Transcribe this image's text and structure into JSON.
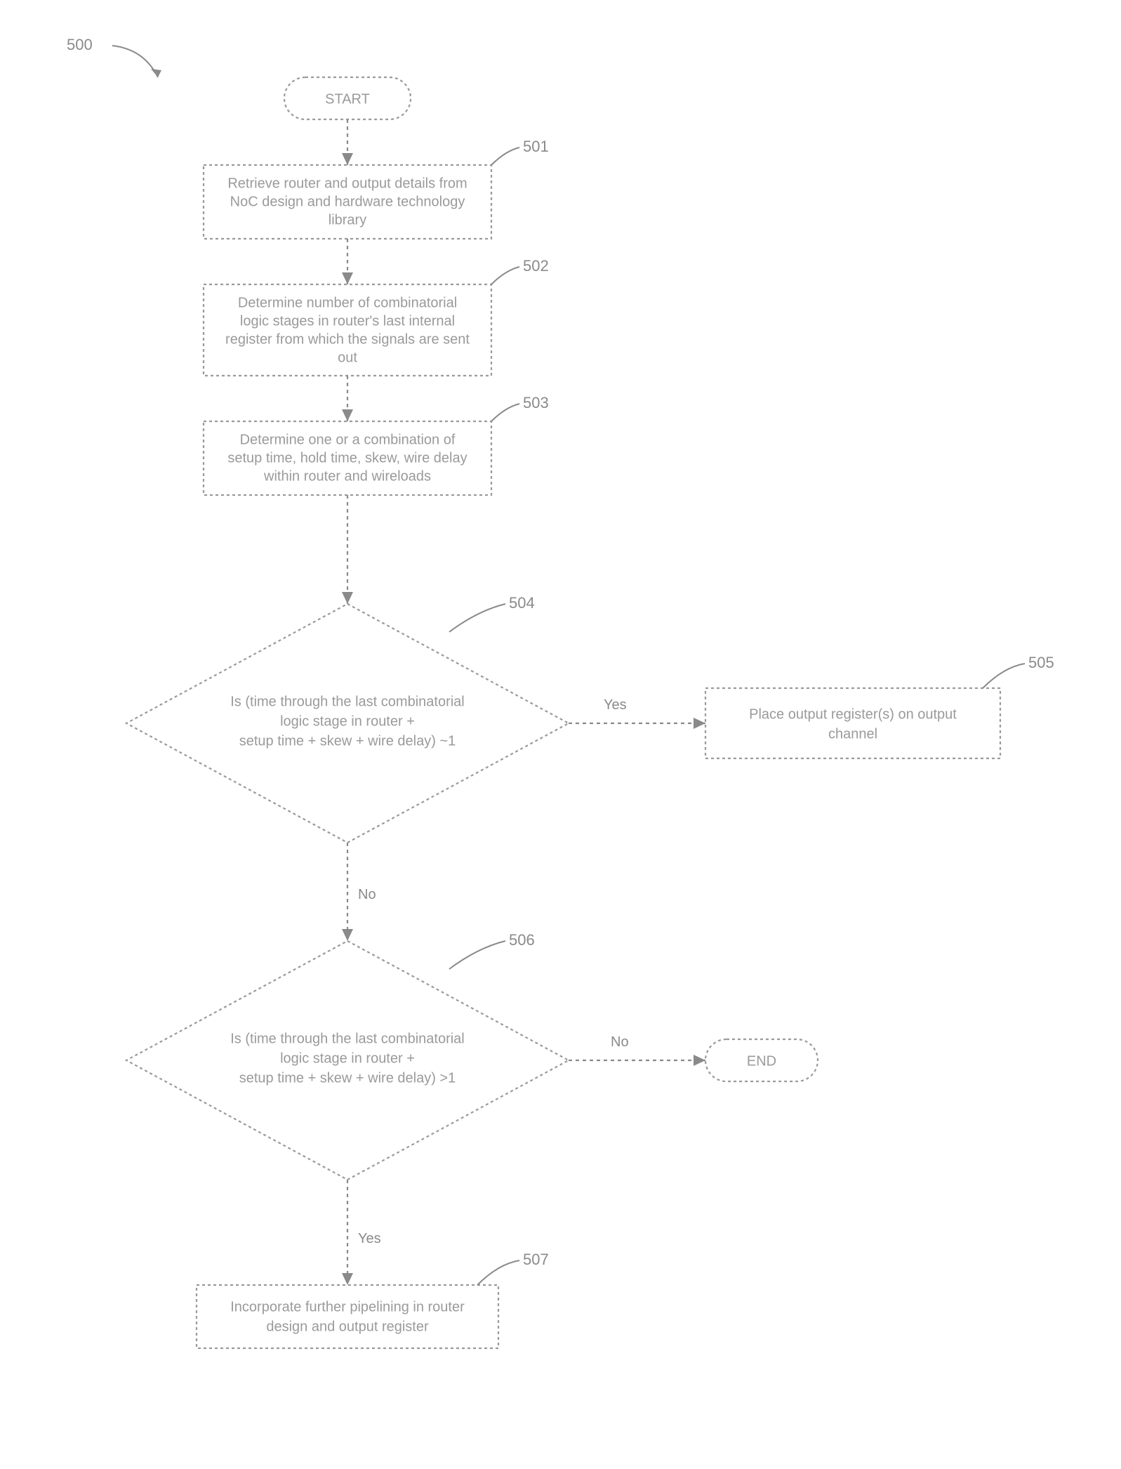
{
  "chart_data": {
    "type": "flowchart",
    "figure_id": "500",
    "nodes": [
      {
        "id": "start",
        "kind": "terminator",
        "text": "START"
      },
      {
        "id": "501",
        "kind": "process",
        "label": "501",
        "text": "Retrieve router and output details from NoC design and hardware technology library"
      },
      {
        "id": "502",
        "kind": "process",
        "label": "502",
        "text": "Determine number of combinatorial logic stages in router's last internal register from which the signals are sent out"
      },
      {
        "id": "503",
        "kind": "process",
        "label": "503",
        "text": "Determine one or a combination of setup time, hold time, skew, wire delay within router and wireloads"
      },
      {
        "id": "504",
        "kind": "decision",
        "label": "504",
        "text": "Is (time through the last combinatorial logic stage in router + setup time + skew + wire delay) ~1"
      },
      {
        "id": "505",
        "kind": "process",
        "label": "505",
        "text": "Place output register(s) on output channel"
      },
      {
        "id": "506",
        "kind": "decision",
        "label": "506",
        "text": "Is (time through the last combinatorial logic stage in router + setup time + skew + wire delay) >1"
      },
      {
        "id": "end",
        "kind": "terminator",
        "text": "END"
      },
      {
        "id": "507",
        "kind": "process",
        "label": "507",
        "text": "Incorporate further pipelining in router design and output register"
      }
    ],
    "edges": [
      {
        "from": "start",
        "to": "501"
      },
      {
        "from": "501",
        "to": "502"
      },
      {
        "from": "502",
        "to": "503"
      },
      {
        "from": "503",
        "to": "504"
      },
      {
        "from": "504",
        "to": "505",
        "label": "Yes"
      },
      {
        "from": "504",
        "to": "506",
        "label": "No"
      },
      {
        "from": "506",
        "to": "end",
        "label": "No"
      },
      {
        "from": "506",
        "to": "507",
        "label": "Yes"
      }
    ]
  },
  "labels": {
    "figure": "500",
    "start": "START",
    "end": "END",
    "n501": "501",
    "n502": "502",
    "n503": "503",
    "n504": "504",
    "n505": "505",
    "n506": "506",
    "n507": "507",
    "yes": "Yes",
    "no": "No",
    "t501_l1": "Retrieve router and output details from",
    "t501_l2": "NoC design and hardware technology",
    "t501_l3": "library",
    "t502_l1": "Determine number of combinatorial",
    "t502_l2": "logic stages in router's last internal",
    "t502_l3": "register from which the signals are sent",
    "t502_l4": "out",
    "t503_l1": "Determine one or a combination of",
    "t503_l2": "setup time, hold time, skew, wire delay",
    "t503_l3": "within router and wireloads",
    "t504_l1": "Is (time through the last combinatorial",
    "t504_l2": "logic stage in router +",
    "t504_l3": "setup time + skew + wire delay) ~1",
    "t505_l1": "Place output register(s) on output",
    "t505_l2": "channel",
    "t506_l1": "Is (time through the last combinatorial",
    "t506_l2": "logic stage in router +",
    "t506_l3": "setup time + skew + wire delay) >1",
    "t507_l1": "Incorporate further pipelining in router",
    "t507_l2": "design and output register"
  }
}
